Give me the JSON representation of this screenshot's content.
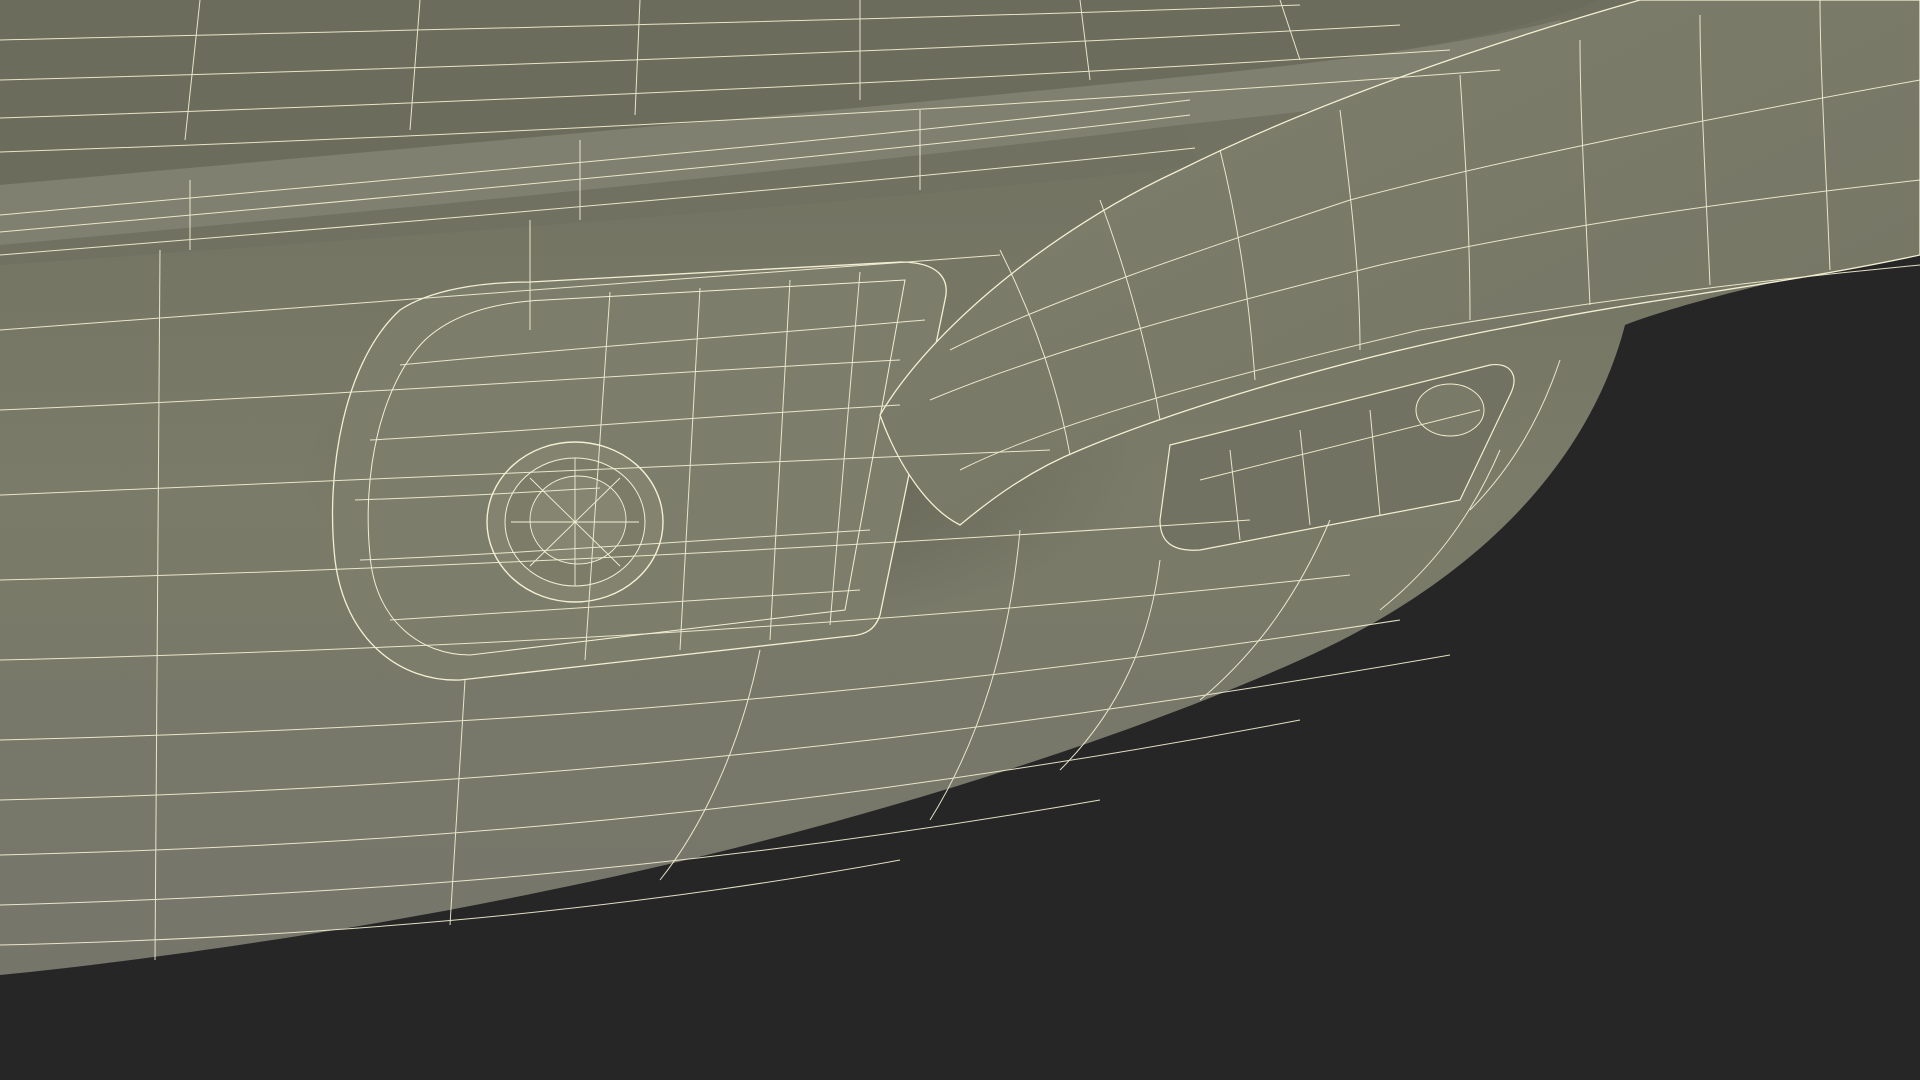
{
  "scene": {
    "subject": "wireframe-render-pan-handle-rivet",
    "colors": {
      "background": "#262626",
      "body": "#7a7a68",
      "body_dark": "#6b6b5a",
      "body_light": "#86867a",
      "wire": "#f2efd2"
    }
  }
}
